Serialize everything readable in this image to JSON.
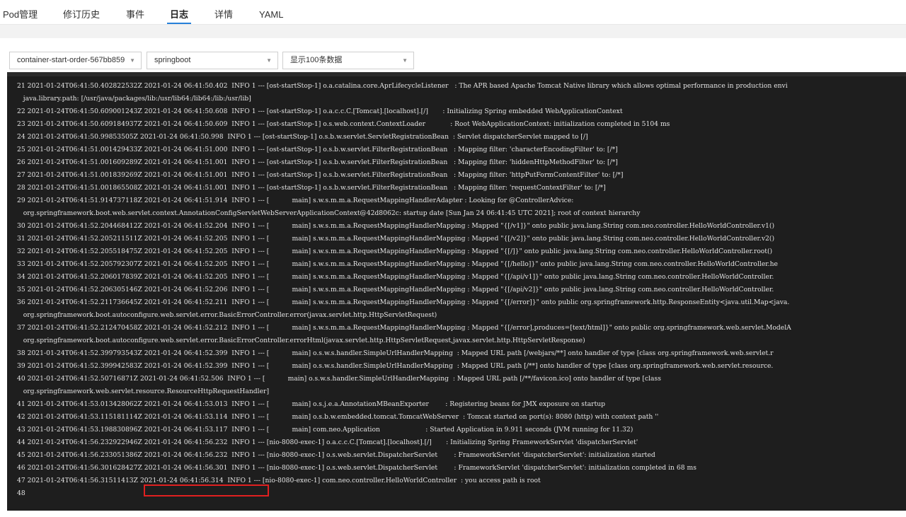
{
  "tabs": [
    {
      "label": "Pod管理"
    },
    {
      "label": "修订历史"
    },
    {
      "label": "事件"
    },
    {
      "label": "日志"
    },
    {
      "label": "详情"
    },
    {
      "label": "YAML"
    }
  ],
  "active_tab": "日志",
  "filters": {
    "container": "container-start-order-567bb859",
    "app": "springboot",
    "rows": "显示100条数据"
  },
  "log_lines": [
    "21 2021-01-24T06:41:50.402822532Z 2021-01-24 06:41:50.402  INFO 1 --- [ost-startStop-1] o.a.catalina.core.AprLifecycleListener   : The APR based Apache Tomcat Native library which allows optimal performance in production envi",
    "   java.library.path: [/usr/java/packages/lib:/usr/lib64:/lib64:/lib:/usr/lib]",
    "22 2021-01-24T06:41:50.609001243Z 2021-01-24 06:41:50.608  INFO 1 --- [ost-startStop-1] o.a.c.c.C.[Tomcat].[localhost].[/]       : Initializing Spring embedded WebApplicationContext",
    "23 2021-01-24T06:41:50.609184937Z 2021-01-24 06:41:50.609  INFO 1 --- [ost-startStop-1] o.s.web.context.ContextLoader            : Root WebApplicationContext: initialization completed in 5104 ms",
    "24 2021-01-24T06:41:50.99853505Z 2021-01-24 06:41:50.998  INFO 1 --- [ost-startStop-1] o.s.b.w.servlet.ServletRegistrationBean  : Servlet dispatcherServlet mapped to [/]",
    "25 2021-01-24T06:41:51.001429433Z 2021-01-24 06:41:51.000  INFO 1 --- [ost-startStop-1] o.s.b.w.servlet.FilterRegistrationBean   : Mapping filter: 'characterEncodingFilter' to: [/*]",
    "26 2021-01-24T06:41:51.001609289Z 2021-01-24 06:41:51.001  INFO 1 --- [ost-startStop-1] o.s.b.w.servlet.FilterRegistrationBean   : Mapping filter: 'hiddenHttpMethodFilter' to: [/*]",
    "27 2021-01-24T06:41:51.001839269Z 2021-01-24 06:41:51.001  INFO 1 --- [ost-startStop-1] o.s.b.w.servlet.FilterRegistrationBean   : Mapping filter: 'httpPutFormContentFilter' to: [/*]",
    "28 2021-01-24T06:41:51.001865508Z 2021-01-24 06:41:51.001  INFO 1 --- [ost-startStop-1] o.s.b.w.servlet.FilterRegistrationBean   : Mapping filter: 'requestContextFilter' to: [/*]",
    "29 2021-01-24T06:41:51.914737118Z 2021-01-24 06:41:51.914  INFO 1 --- [           main] s.w.s.m.m.a.RequestMappingHandlerAdapter : Looking for @ControllerAdvice:",
    "   org.springframework.boot.web.servlet.context.AnnotationConfigServletWebServerApplicationContext@42d8062c: startup date [Sun Jan 24 06:41:45 UTC 2021]; root of context hierarchy",
    "30 2021-01-24T06:41:52.204468412Z 2021-01-24 06:41:52.204  INFO 1 --- [           main] s.w.s.m.m.a.RequestMappingHandlerMapping : Mapped \"{[/v1]}\" onto public java.lang.String com.neo.controller.HelloWorldController.v1()",
    "31 2021-01-24T06:41:52.205211511Z 2021-01-24 06:41:52.205  INFO 1 --- [           main] s.w.s.m.m.a.RequestMappingHandlerMapping : Mapped \"{[/v2]}\" onto public java.lang.String com.neo.controller.HelloWorldController.v2()",
    "32 2021-01-24T06:41:52.205518475Z 2021-01-24 06:41:52.205  INFO 1 --- [           main] s.w.s.m.m.a.RequestMappingHandlerMapping : Mapped \"{[/]}\" onto public java.lang.String com.neo.controller.HelloWorldController.root()",
    "33 2021-01-24T06:41:52.205792307Z 2021-01-24 06:41:52.205  INFO 1 --- [           main] s.w.s.m.m.a.RequestMappingHandlerMapping : Mapped \"{[/hello]}\" onto public java.lang.String com.neo.controller.HelloWorldController.he",
    "34 2021-01-24T06:41:52.206017839Z 2021-01-24 06:41:52.205  INFO 1 --- [           main] s.w.s.m.m.a.RequestMappingHandlerMapping : Mapped \"{[/api/v1]}\" onto public java.lang.String com.neo.controller.HelloWorldController.",
    "35 2021-01-24T06:41:52.206305146Z 2021-01-24 06:41:52.206  INFO 1 --- [           main] s.w.s.m.m.a.RequestMappingHandlerMapping : Mapped \"{[/api/v2]}\" onto public java.lang.String com.neo.controller.HelloWorldController.",
    "36 2021-01-24T06:41:52.211736645Z 2021-01-24 06:41:52.211  INFO 1 --- [           main] s.w.s.m.m.a.RequestMappingHandlerMapping : Mapped \"{[/error]}\" onto public org.springframework.http.ResponseEntity<java.util.Map<java.",
    "   org.springframework.boot.autoconfigure.web.servlet.error.BasicErrorController.error(javax.servlet.http.HttpServletRequest)",
    "37 2021-01-24T06:41:52.212470458Z 2021-01-24 06:41:52.212  INFO 1 --- [           main] s.w.s.m.m.a.RequestMappingHandlerMapping : Mapped \"{[/error],produces=[text/html]}\" onto public org.springframework.web.servlet.ModelA",
    "   org.springframework.boot.autoconfigure.web.servlet.error.BasicErrorController.errorHtml(javax.servlet.http.HttpServletRequest,javax.servlet.http.HttpServletResponse)",
    "38 2021-01-24T06:41:52.399793543Z 2021-01-24 06:41:52.399  INFO 1 --- [           main] o.s.w.s.handler.SimpleUrlHandlerMapping  : Mapped URL path [/webjars/**] onto handler of type [class org.springframework.web.servlet.r",
    "39 2021-01-24T06:41:52.399942583Z 2021-01-24 06:41:52.399  INFO 1 --- [           main] o.s.w.s.handler.SimpleUrlHandlerMapping  : Mapped URL path [/**] onto handler of type [class org.springframework.web.servlet.resource.",
    "40 2021-01-24T06:41:52.50716871Z 2021-01-24 06:41:52.506  INFO 1 --- [           main] o.s.w.s.handler.SimpleUrlHandlerMapping  : Mapped URL path [/**/favicon.ico] onto handler of type [class",
    "   org.springframework.web.servlet.resource.ResourceHttpRequestHandler]",
    "41 2021-01-24T06:41:53.013428062Z 2021-01-24 06:41:53.013  INFO 1 --- [           main] o.s.j.e.a.AnnotationMBeanExporter        : Registering beans for JMX exposure on startup",
    "42 2021-01-24T06:41:53.115181114Z 2021-01-24 06:41:53.114  INFO 1 --- [           main] o.s.b.w.embedded.tomcat.TomcatWebServer  : Tomcat started on port(s): 8080 (http) with context path ''",
    "43 2021-01-24T06:41:53.198830896Z 2021-01-24 06:41:53.117  INFO 1 --- [           main] com.neo.Application                      : Started Application in 9.911 seconds (JVM running for 11.32)",
    "44 2021-01-24T06:41:56.232922946Z 2021-01-24 06:41:56.232  INFO 1 --- [nio-8080-exec-1] o.a.c.c.C.[Tomcat].[localhost].[/]       : Initializing Spring FrameworkServlet 'dispatcherServlet'",
    "45 2021-01-24T06:41:56.233051386Z 2021-01-24 06:41:56.232  INFO 1 --- [nio-8080-exec-1] o.s.web.servlet.DispatcherServlet        : FrameworkServlet 'dispatcherServlet': initialization started",
    "46 2021-01-24T06:41:56.301628427Z 2021-01-24 06:41:56.301  INFO 1 --- [nio-8080-exec-1] o.s.web.servlet.DispatcherServlet        : FrameworkServlet 'dispatcherServlet': initialization completed in 68 ms",
    "47 2021-01-24T06:41:56.31511413Z 2021-01-24 06:41:56.314  INFO 1 --- [nio-8080-exec-1] com.neo.controller.HelloWorldController  : you access path is root",
    "48"
  ],
  "colors": {
    "accent": "#2680d9",
    "log_background": "#1e1e1e",
    "highlight_box": "#e02020"
  },
  "icons": {
    "dropdown": "chevron-down-icon"
  }
}
